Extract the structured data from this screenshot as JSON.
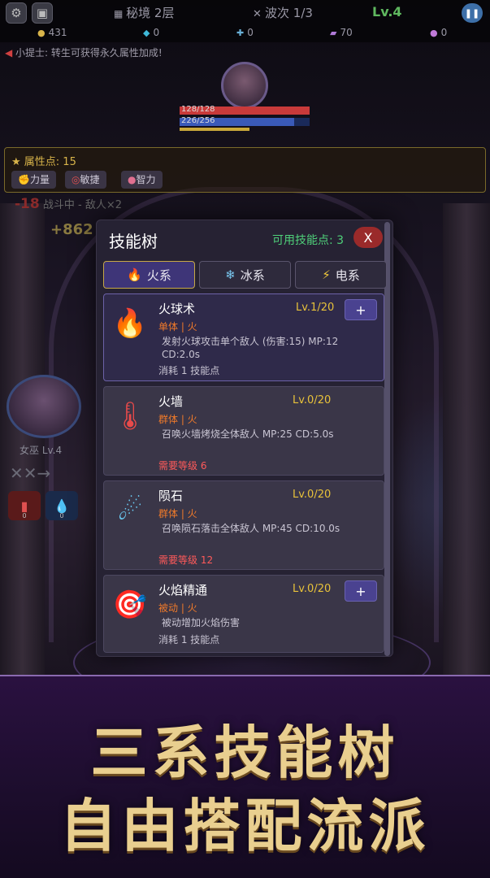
{
  "hud": {
    "settings_icon": "gear-icon",
    "save_icon": "save-icon",
    "stage_title": "秘境 2层",
    "wave_text": "波次 1/3",
    "level": "Lv.4",
    "pause_icon": "pause-icon"
  },
  "resources": [
    {
      "icon": "gold-bag-icon",
      "value": "431",
      "color": "#d8b44a"
    },
    {
      "icon": "diamond-icon",
      "value": "0",
      "color": "#3fb8d8"
    },
    {
      "icon": "cross-gem-icon",
      "value": "0",
      "color": "#6ab0d8"
    },
    {
      "icon": "book-icon",
      "value": "70",
      "color": "#b07ad8"
    },
    {
      "icon": "orb-icon",
      "value": "0",
      "color": "#c07ad8"
    }
  ],
  "tip": "小提士: 转生可获得永久属性加成!",
  "enemy": {
    "hp": "128/128",
    "mp": "226/256",
    "hp_fraction": 1.0,
    "mp_fraction": 0.88
  },
  "attributes": {
    "title": "属性点: 15",
    "buttons": [
      "力量",
      "敏捷",
      "智力"
    ]
  },
  "battle_status": "战斗中 - 敌人×2",
  "damage_miss": "-18",
  "damage_gain": "+862",
  "hero": {
    "name": "女巫 Lv.4",
    "marks": "✕✕→"
  },
  "potions": [
    {
      "icon": "potion-red-icon",
      "count": "0"
    },
    {
      "icon": "potion-blue-icon",
      "count": "0"
    }
  ],
  "skill_tree": {
    "title": "技能树",
    "skill_points": "可用技能点: 3",
    "close": "X",
    "tabs": [
      {
        "icon": "🔥",
        "label": "火系",
        "active": true
      },
      {
        "icon": "❄",
        "label": "冰系",
        "active": false
      },
      {
        "icon": "⚡",
        "label": "电系",
        "active": false
      }
    ],
    "skills": [
      {
        "icon": "🔥",
        "name": "火球术",
        "level": "Lv.1/20",
        "tag": "单体 | 火",
        "desc": "发射火球攻击单个敌人 (伤害:15) MP:12  CD:2.0s",
        "cost": "消耗 1 技能点",
        "can_add": true
      },
      {
        "icon": "🌡",
        "name": "火墙",
        "level": "Lv.0/20",
        "tag": "群体 | 火",
        "desc": "召唤火墙烤烧全体敌人  MP:25  CD:5.0s",
        "req": "需要等级 6",
        "can_add": false
      },
      {
        "icon": "☄",
        "name": "陨石",
        "level": "Lv.0/20",
        "tag": "群体 | 火",
        "desc": "召唤陨石落击全体敌人  MP:45  CD:10.0s",
        "req": "需要等级 12",
        "can_add": false
      },
      {
        "icon": "🎯",
        "name": "火焰精通",
        "level": "Lv.0/20",
        "tag": "被动 | 火",
        "desc": "被动增加火焰伤害",
        "cost": "消耗 1 技能点",
        "can_add": true
      }
    ],
    "add_label": "+"
  },
  "banner": {
    "line1": "三系技能树",
    "line2": "自由搭配流派"
  }
}
